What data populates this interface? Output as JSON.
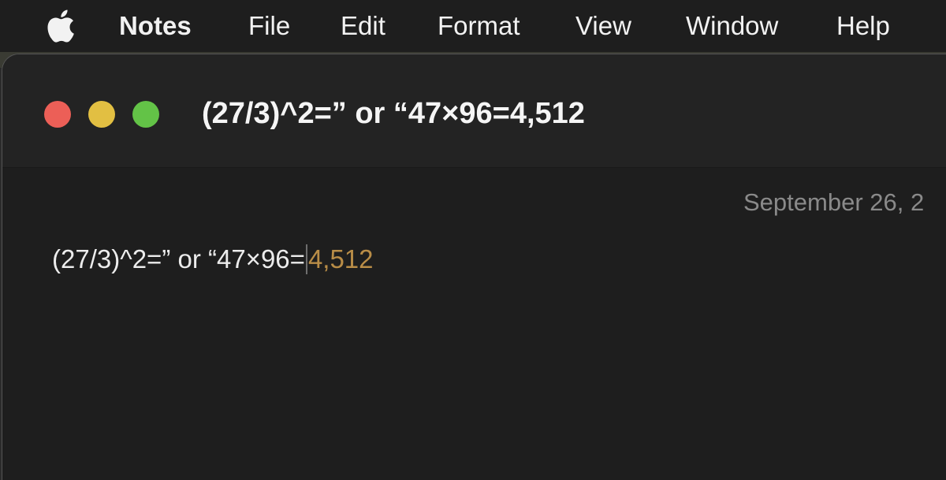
{
  "menubar": {
    "apple_icon": "apple-logo-icon",
    "app_name": "Notes",
    "items": [
      "File",
      "Edit",
      "Format",
      "View",
      "Window",
      "Help"
    ]
  },
  "window": {
    "title": "(27/3)^2=” or “47×96=4,512",
    "traffic_lights": {
      "close_color": "#ec5f57",
      "minimize_color": "#e2bf42",
      "zoom_color": "#63c347"
    }
  },
  "note": {
    "date": "September 26, 2",
    "typed_text": "(27/3)^2=” or “47×96=",
    "suggested_text": "4,512",
    "suggestion_color": "#b98d47"
  }
}
